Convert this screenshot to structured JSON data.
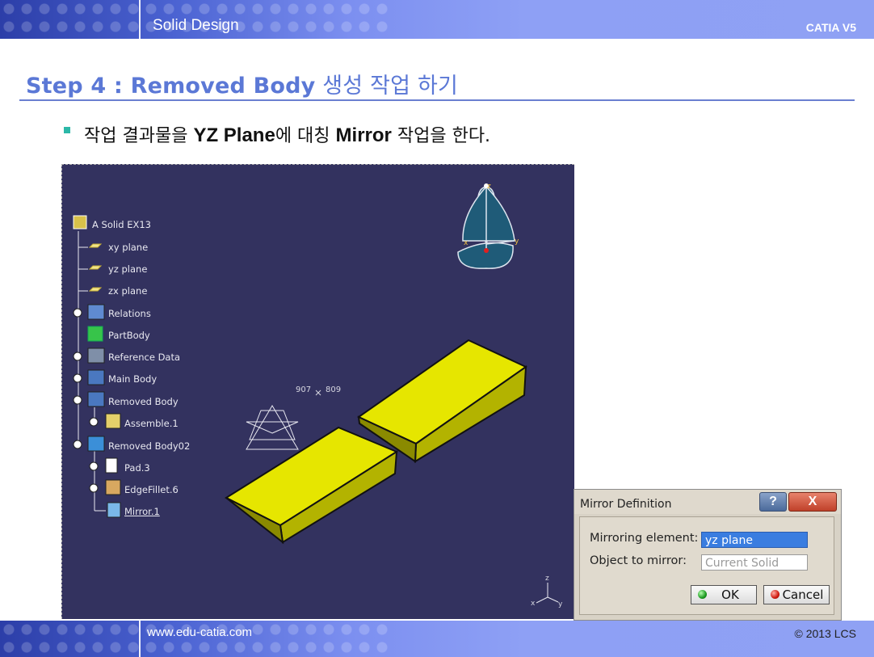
{
  "header": {
    "title": "Solid Design",
    "product": "CATIA V5"
  },
  "footer": {
    "url": "www.edu-catia.com",
    "copyright": "© 2013 LCS"
  },
  "step": {
    "prefix": "Step 4 : Removed Body",
    "suffix": " 생성 작업 하기"
  },
  "bullet": {
    "part1": "작업 결과물을 ",
    "bold1": "YZ Plane",
    "part2": "에 대칭 ",
    "bold2": "Mirror",
    "part3": " 작업을 한다."
  },
  "tree": {
    "root": "A Solid EX13",
    "items": [
      "xy plane",
      "yz plane",
      "zx plane",
      "Relations",
      "PartBody",
      "Reference Data",
      "Main Body",
      "Removed Body",
      "Assemble.1",
      "Removed Body02",
      "Pad.3",
      "EdgeFillet.6",
      "Mirror.1"
    ]
  },
  "viewport": {
    "coord_x": "907",
    "coord_y": "809",
    "compass_z": "z",
    "compass_y": "y",
    "compass_x": "x",
    "axis_z": "z",
    "axis_y": "y",
    "axis_x": "x"
  },
  "dialog": {
    "title": "Mirror Definition",
    "help": "?",
    "close": "X",
    "mirroring_label": "Mirroring element:",
    "mirroring_value": "yz plane",
    "object_label": "Object to mirror:",
    "object_value": "Current Solid",
    "ok": "OK",
    "cancel": "Cancel"
  },
  "colors": {
    "accent": "#5b78d6",
    "viewport_bg": "#33325f",
    "solid": "#e6e600",
    "field_selected": "#3a7de0"
  }
}
